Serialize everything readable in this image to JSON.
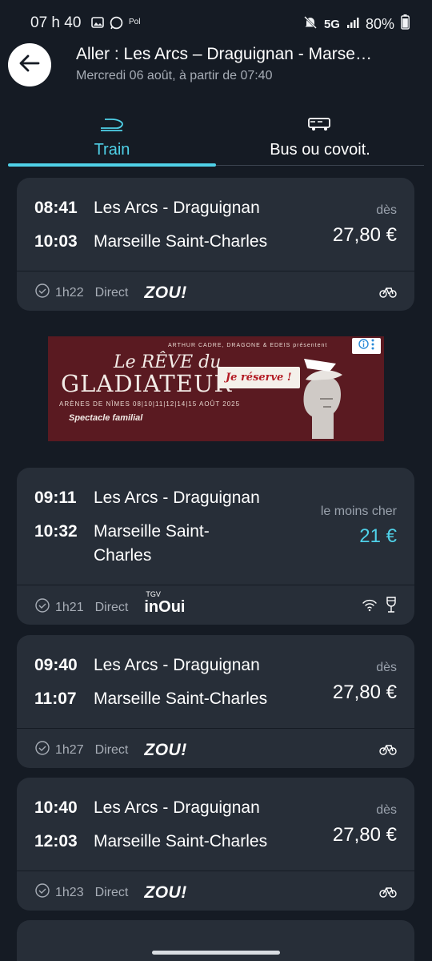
{
  "status_bar": {
    "time": "07 h 40",
    "extra": "Pol",
    "network": "5G",
    "battery": "80%"
  },
  "header": {
    "title": "Aller : Les Arcs – Draguignan - Marse…",
    "subtitle": "Mercredi 06 août, à partir de 07:40"
  },
  "tabs": [
    {
      "label": "Train",
      "icon": "train-icon",
      "active": true
    },
    {
      "label": "Bus ou covoit.",
      "icon": "bus-icon",
      "active": false
    }
  ],
  "colors": {
    "background": "#151b24",
    "card": "#272e38",
    "accent": "#4fd1e8"
  },
  "journeys": [
    {
      "dep_time": "08:41",
      "dep_station": "Les Arcs - Draguignan",
      "arr_time": "10:03",
      "arr_station": "Marseille Saint-Charles",
      "price_label": "dès",
      "price": "27,80 €",
      "duration": "1h22",
      "type": "Direct",
      "brand": "ZOU!",
      "amenities": [
        "bike-icon"
      ]
    },
    {
      "dep_time": "09:11",
      "dep_station": "Les Arcs - Draguignan",
      "arr_time": "10:32",
      "arr_station_line1": "Marseille Saint-",
      "arr_station_line2": "Charles",
      "price_label": "le moins cher",
      "price": "21 €",
      "duration": "1h21",
      "type": "Direct",
      "brand_small": "TGV",
      "brand": "inOui",
      "amenities": [
        "wifi-icon",
        "bar-icon"
      ]
    },
    {
      "dep_time": "09:40",
      "dep_station": "Les Arcs - Draguignan",
      "arr_time": "11:07",
      "arr_station": "Marseille Saint-Charles",
      "price_label": "dès",
      "price": "27,80 €",
      "duration": "1h27",
      "type": "Direct",
      "brand": "ZOU!",
      "amenities": [
        "bike-icon"
      ]
    },
    {
      "dep_time": "10:40",
      "dep_station": "Les Arcs - Draguignan",
      "arr_time": "12:03",
      "arr_station": "Marseille Saint-Charles",
      "price_label": "dès",
      "price": "27,80 €",
      "duration": "1h23",
      "type": "Direct",
      "brand": "ZOU!",
      "amenities": [
        "bike-icon"
      ]
    }
  ],
  "ad": {
    "top_line": "ARTHUR CADRE, DRAGONE & EDEIS présentent",
    "title_line1": "Le RÊVE du",
    "title_line2": "GLADIATEUR",
    "dates": "ARÈNES DE NÎMES 08|10|11|12|14|15 AOÛT 2025",
    "tagline": "Spectacle familial",
    "cta": "Je réserve !"
  }
}
